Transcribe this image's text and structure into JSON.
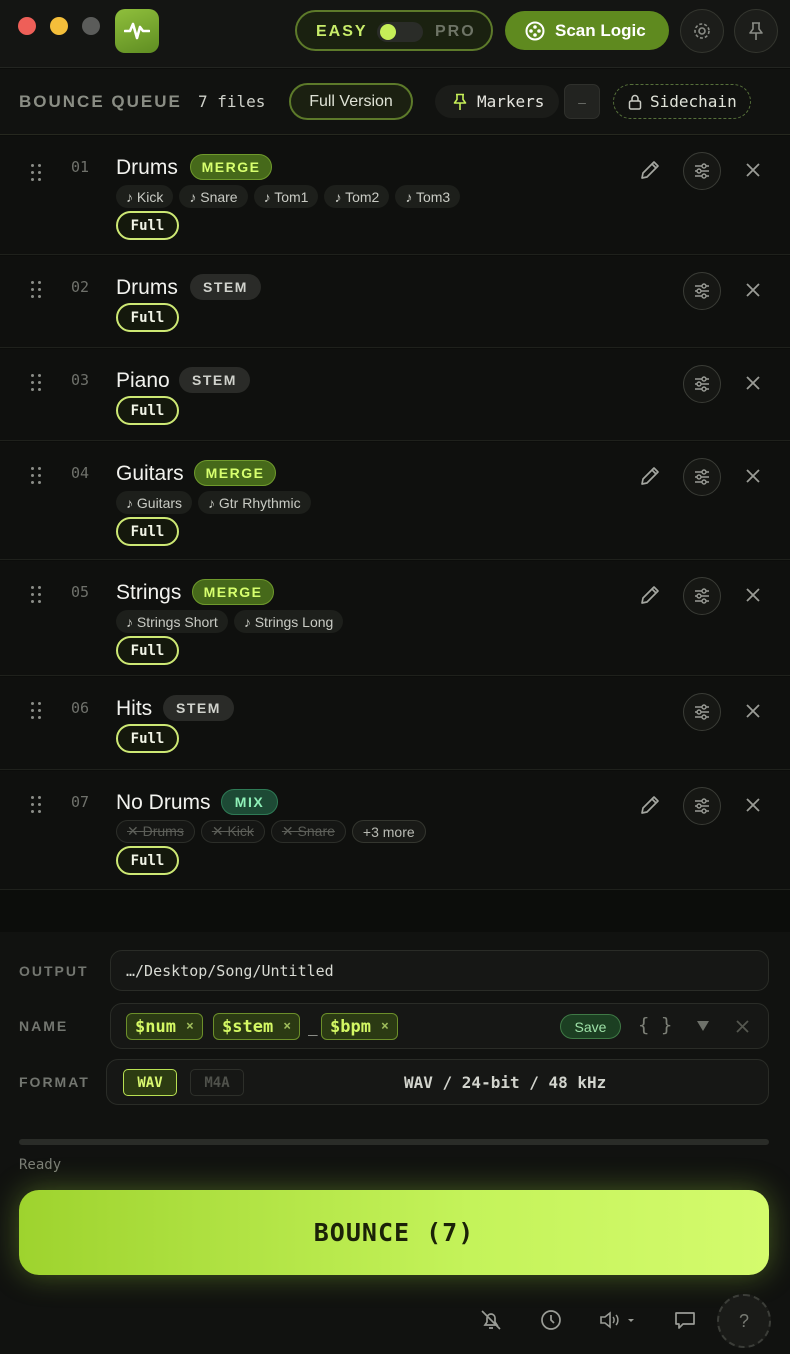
{
  "header": {
    "mode": {
      "easy": "EASY",
      "pro": "PRO"
    },
    "scan_label": "Scan Logic"
  },
  "queue": {
    "title": "BOUNCE QUEUE",
    "count": "7 files",
    "full_version": "Full Version",
    "markers": "Markers",
    "minus": "–",
    "sidechain": "Sidechain"
  },
  "tracks": [
    {
      "num": "01",
      "name": "Drums",
      "type": "MERGE",
      "chips": [
        "♪ Kick",
        "♪ Snare",
        "♪ Tom1",
        "♪ Tom2",
        "♪ Tom3"
      ],
      "range": "Full"
    },
    {
      "num": "02",
      "name": "Drums",
      "type": "STEM",
      "chips": [],
      "range": "Full"
    },
    {
      "num": "03",
      "name": "Piano",
      "type": "STEM",
      "chips": [],
      "range": "Full"
    },
    {
      "num": "04",
      "name": "Guitars",
      "type": "MERGE",
      "chips": [
        "♪ Guitars",
        "♪ Gtr Rhythmic"
      ],
      "range": "Full"
    },
    {
      "num": "05",
      "name": "Strings",
      "type": "MERGE",
      "chips": [
        "♪ Strings Short",
        "♪ Strings Long"
      ],
      "range": "Full"
    },
    {
      "num": "06",
      "name": "Hits",
      "type": "STEM",
      "chips": [],
      "range": "Full"
    },
    {
      "num": "07",
      "name": "No Drums",
      "type": "MIX",
      "chips": [
        "✕ Drums",
        "✕ Kick",
        "✕ Snare"
      ],
      "more": "+3 more",
      "range": "Full"
    }
  ],
  "output": {
    "output_label": "OUTPUT",
    "path": "…/Desktop/Song/Untitled",
    "name_label": "NAME",
    "tokens": [
      "$num",
      "$stem",
      "$bpm"
    ],
    "token_remove": "×",
    "separator": "_",
    "save": "Save",
    "braces": "{ }",
    "format_label": "FORMAT",
    "formats": [
      "WAV",
      "M4A"
    ],
    "format_summary": "WAV / 24-bit / 48 kHz"
  },
  "status": "Ready",
  "bounce_label": "BOUNCE (7)",
  "help": "?",
  "colors": {
    "accent": "#c4f35a",
    "merge": "#46691a",
    "mix": "#1d4a35",
    "background": "#0c0d0b"
  }
}
